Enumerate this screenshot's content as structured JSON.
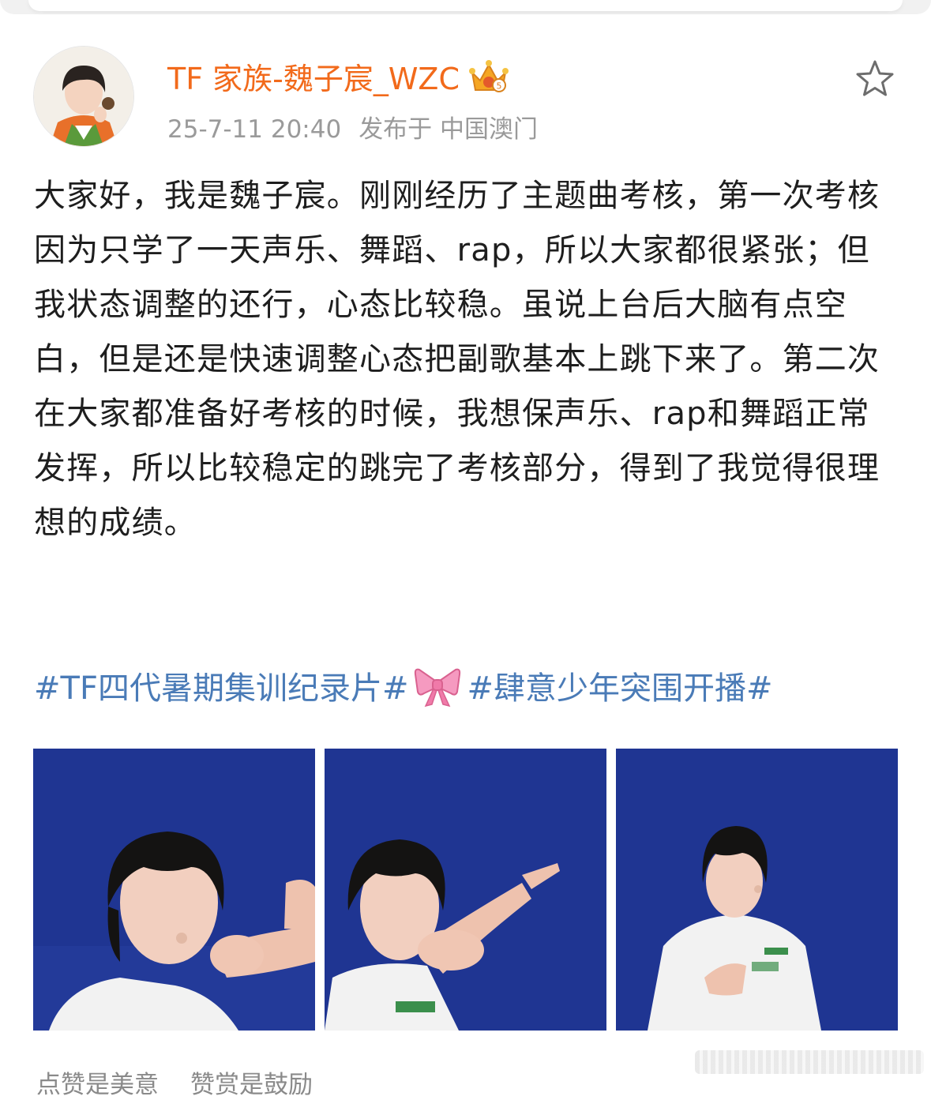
{
  "colors": {
    "username": "#f26a1b",
    "meta": "#9a9a9a",
    "body_text": "#1e1e1e",
    "hashtag": "#4a7bb7",
    "photo_background": "#1f3592"
  },
  "author": {
    "name": "TF 家族-魏子宸_WZC",
    "badge_icon": "crown-vip-icon",
    "avatar_icon": "avatar-photo"
  },
  "meta": {
    "timestamp": "25-7-11 20:40",
    "location": "发布于 中国澳门"
  },
  "actions": {
    "favorite_icon": "star-outline-icon"
  },
  "post": {
    "paragraphs": [
      "大家好，我是魏子宸。刚刚经历了主题曲考核，第一次考核因为只学了一天声乐、舞蹈、rap，所以大家都很紧张；但我状态调整的还行，心态比较稳。虽说上台后大脑有点空白，但是还是快速调整心态把副歌基本上跳下来了。第二次在大家都准备好考核的时候，我想保声乐、rap和舞蹈正常发挥，所以比较稳定的跳完了考核部分，得到了我觉得很理想的成绩。"
    ]
  },
  "hashtags": {
    "first": "#TF四代暑期集训纪录片#",
    "separator_icon": "pink-bow-emoji",
    "second": "#肆意少年突围开播#"
  },
  "photos": [
    {
      "icon": "photo-holding-wrist"
    },
    {
      "icon": "photo-pointing"
    },
    {
      "icon": "photo-hand-on-chest"
    }
  ],
  "footer": {
    "like_text": "点赞是美意",
    "reward_text": "赞赏是鼓励"
  }
}
